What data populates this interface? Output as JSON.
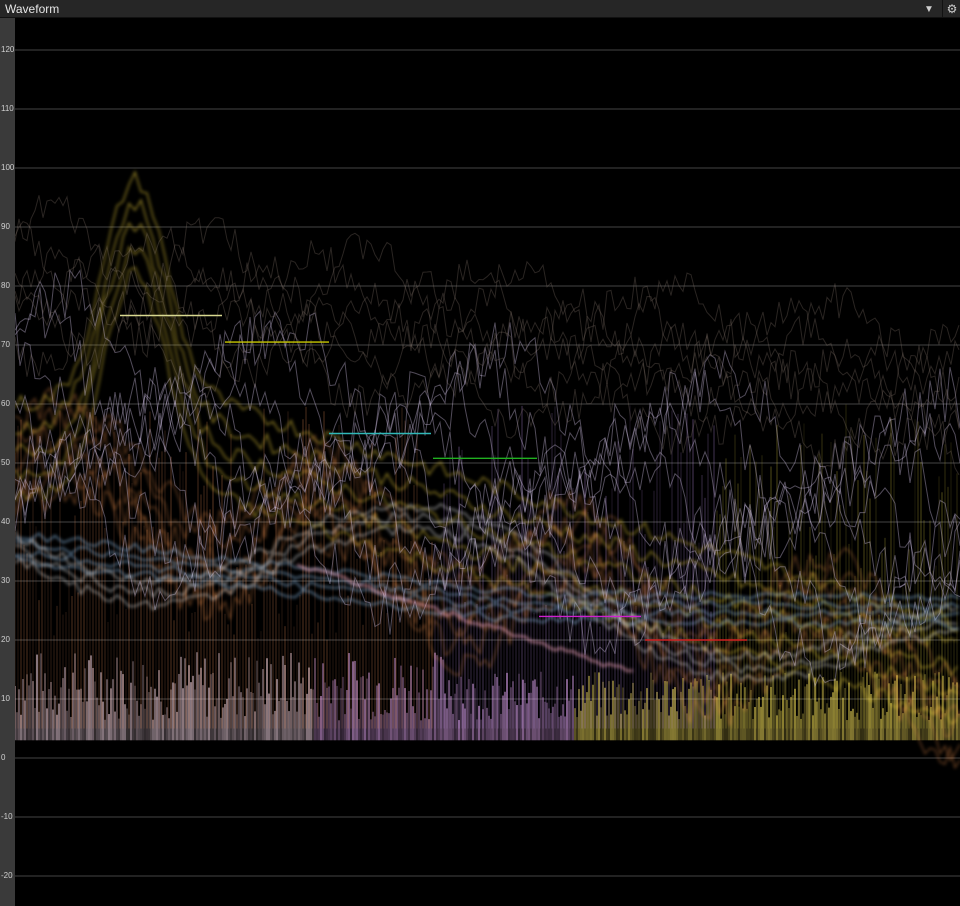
{
  "window": {
    "title": "Waveform",
    "dropdown_icon": "chevron-down-icon",
    "settings_icon": "gear-icon"
  },
  "scale": {
    "labels": [
      "120",
      "110",
      "100",
      "90",
      "80",
      "70",
      "60",
      "50",
      "40",
      "30",
      "20",
      "10",
      "0",
      "-10",
      "-20"
    ],
    "values": [
      120,
      110,
      100,
      90,
      80,
      70,
      60,
      50,
      40,
      30,
      20,
      10,
      0,
      -10,
      -20
    ]
  },
  "colors": {
    "background": "#000000",
    "ruler": "#3a3a3a",
    "gridline": "#5a5a5a",
    "titlebar": "#262626"
  },
  "reference_markers": [
    {
      "color": "#d8d890",
      "level": 75
    },
    {
      "color": "#c8c800",
      "level": 70.5
    },
    {
      "color": "#2fb8b8",
      "level": 55
    },
    {
      "color": "#20b020",
      "level": 50.8
    },
    {
      "color": "#d020d0",
      "level": 24
    },
    {
      "color": "#d02020",
      "level": 20
    }
  ]
}
